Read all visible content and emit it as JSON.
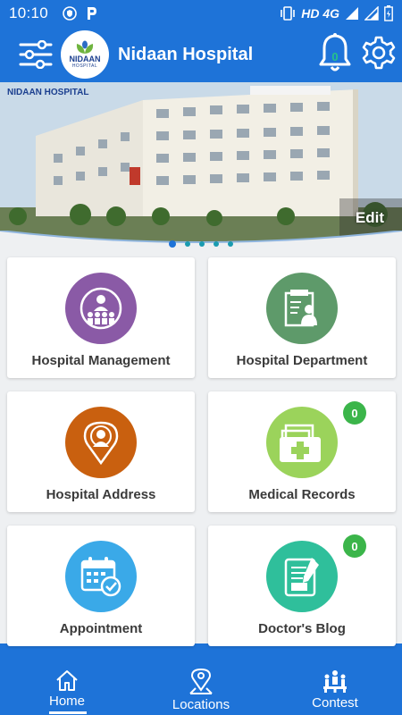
{
  "status_bar": {
    "time": "10:10",
    "network": "HD 4G"
  },
  "header": {
    "title": "Nidaan Hospital",
    "logo_text": "NIDAAN",
    "logo_sub": "HOSPITAL",
    "notification_count": "0"
  },
  "banner": {
    "edit_label": "Edit",
    "logo_text": "NIDAAN HOSPITAL",
    "slide_count": 5,
    "active_slide": 1
  },
  "menu": [
    {
      "label": "Hospital Management",
      "color": "#8a5aa6",
      "icon": "team-icon"
    },
    {
      "label": "Hospital Department",
      "color": "#5e9a6a",
      "icon": "department-icon"
    },
    {
      "label": "Hospital Address",
      "color": "#c9600f",
      "icon": "location-icon"
    },
    {
      "label": "Medical Records",
      "color": "#9bd35b",
      "icon": "records-icon",
      "badge": "0"
    },
    {
      "label": "Appointment",
      "color": "#3aa9e8",
      "icon": "calendar-icon"
    },
    {
      "label": "Doctor's Blog",
      "color": "#2fbf9b",
      "icon": "blog-icon",
      "badge": "0"
    }
  ],
  "bottom_nav": [
    {
      "label": "Home",
      "icon": "home-icon"
    },
    {
      "label": "Locations",
      "icon": "location-pin-icon"
    },
    {
      "label": "Contest",
      "icon": "contest-icon"
    }
  ],
  "colors": {
    "primary": "#1e73d8",
    "badge": "#3bb54a"
  }
}
